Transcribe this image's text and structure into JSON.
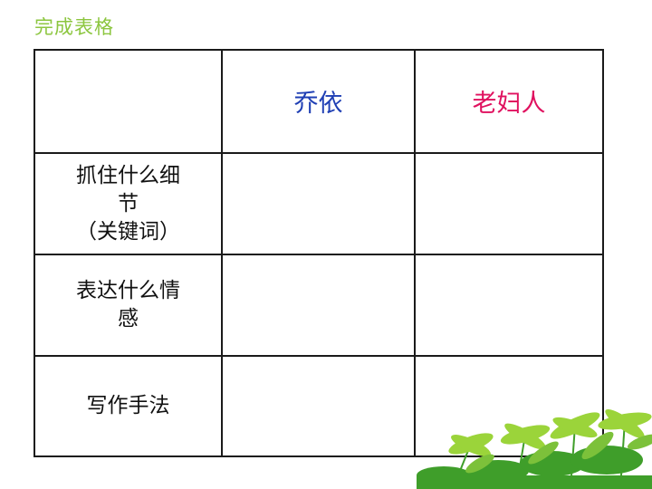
{
  "slide": {
    "title": "完成表格"
  },
  "table": {
    "corner": "",
    "column_headers": [
      {
        "label": "乔依",
        "color": "#1f3fb4"
      },
      {
        "label": "老妇人",
        "color": "#e0115f"
      }
    ],
    "rows": [
      {
        "label": "抓住什么细节（关键词）",
        "line1": "抓住什么细",
        "line2": "节",
        "line3": "（关键词）",
        "cells": [
          "",
          ""
        ]
      },
      {
        "label": "表达什么情感",
        "line1": "表达什么情",
        "line2": "感",
        "cells": [
          "",
          ""
        ]
      },
      {
        "label": "写作手法",
        "line1": "写作手法",
        "cells": [
          "",
          ""
        ]
      }
    ]
  },
  "colors": {
    "title": "#8cc63f",
    "border": "#1a1a1a",
    "foliage_light": "#9bd43a",
    "foliage_dark": "#3f9e2a"
  },
  "decoration": {
    "icon": "palm-foliage-icon"
  }
}
